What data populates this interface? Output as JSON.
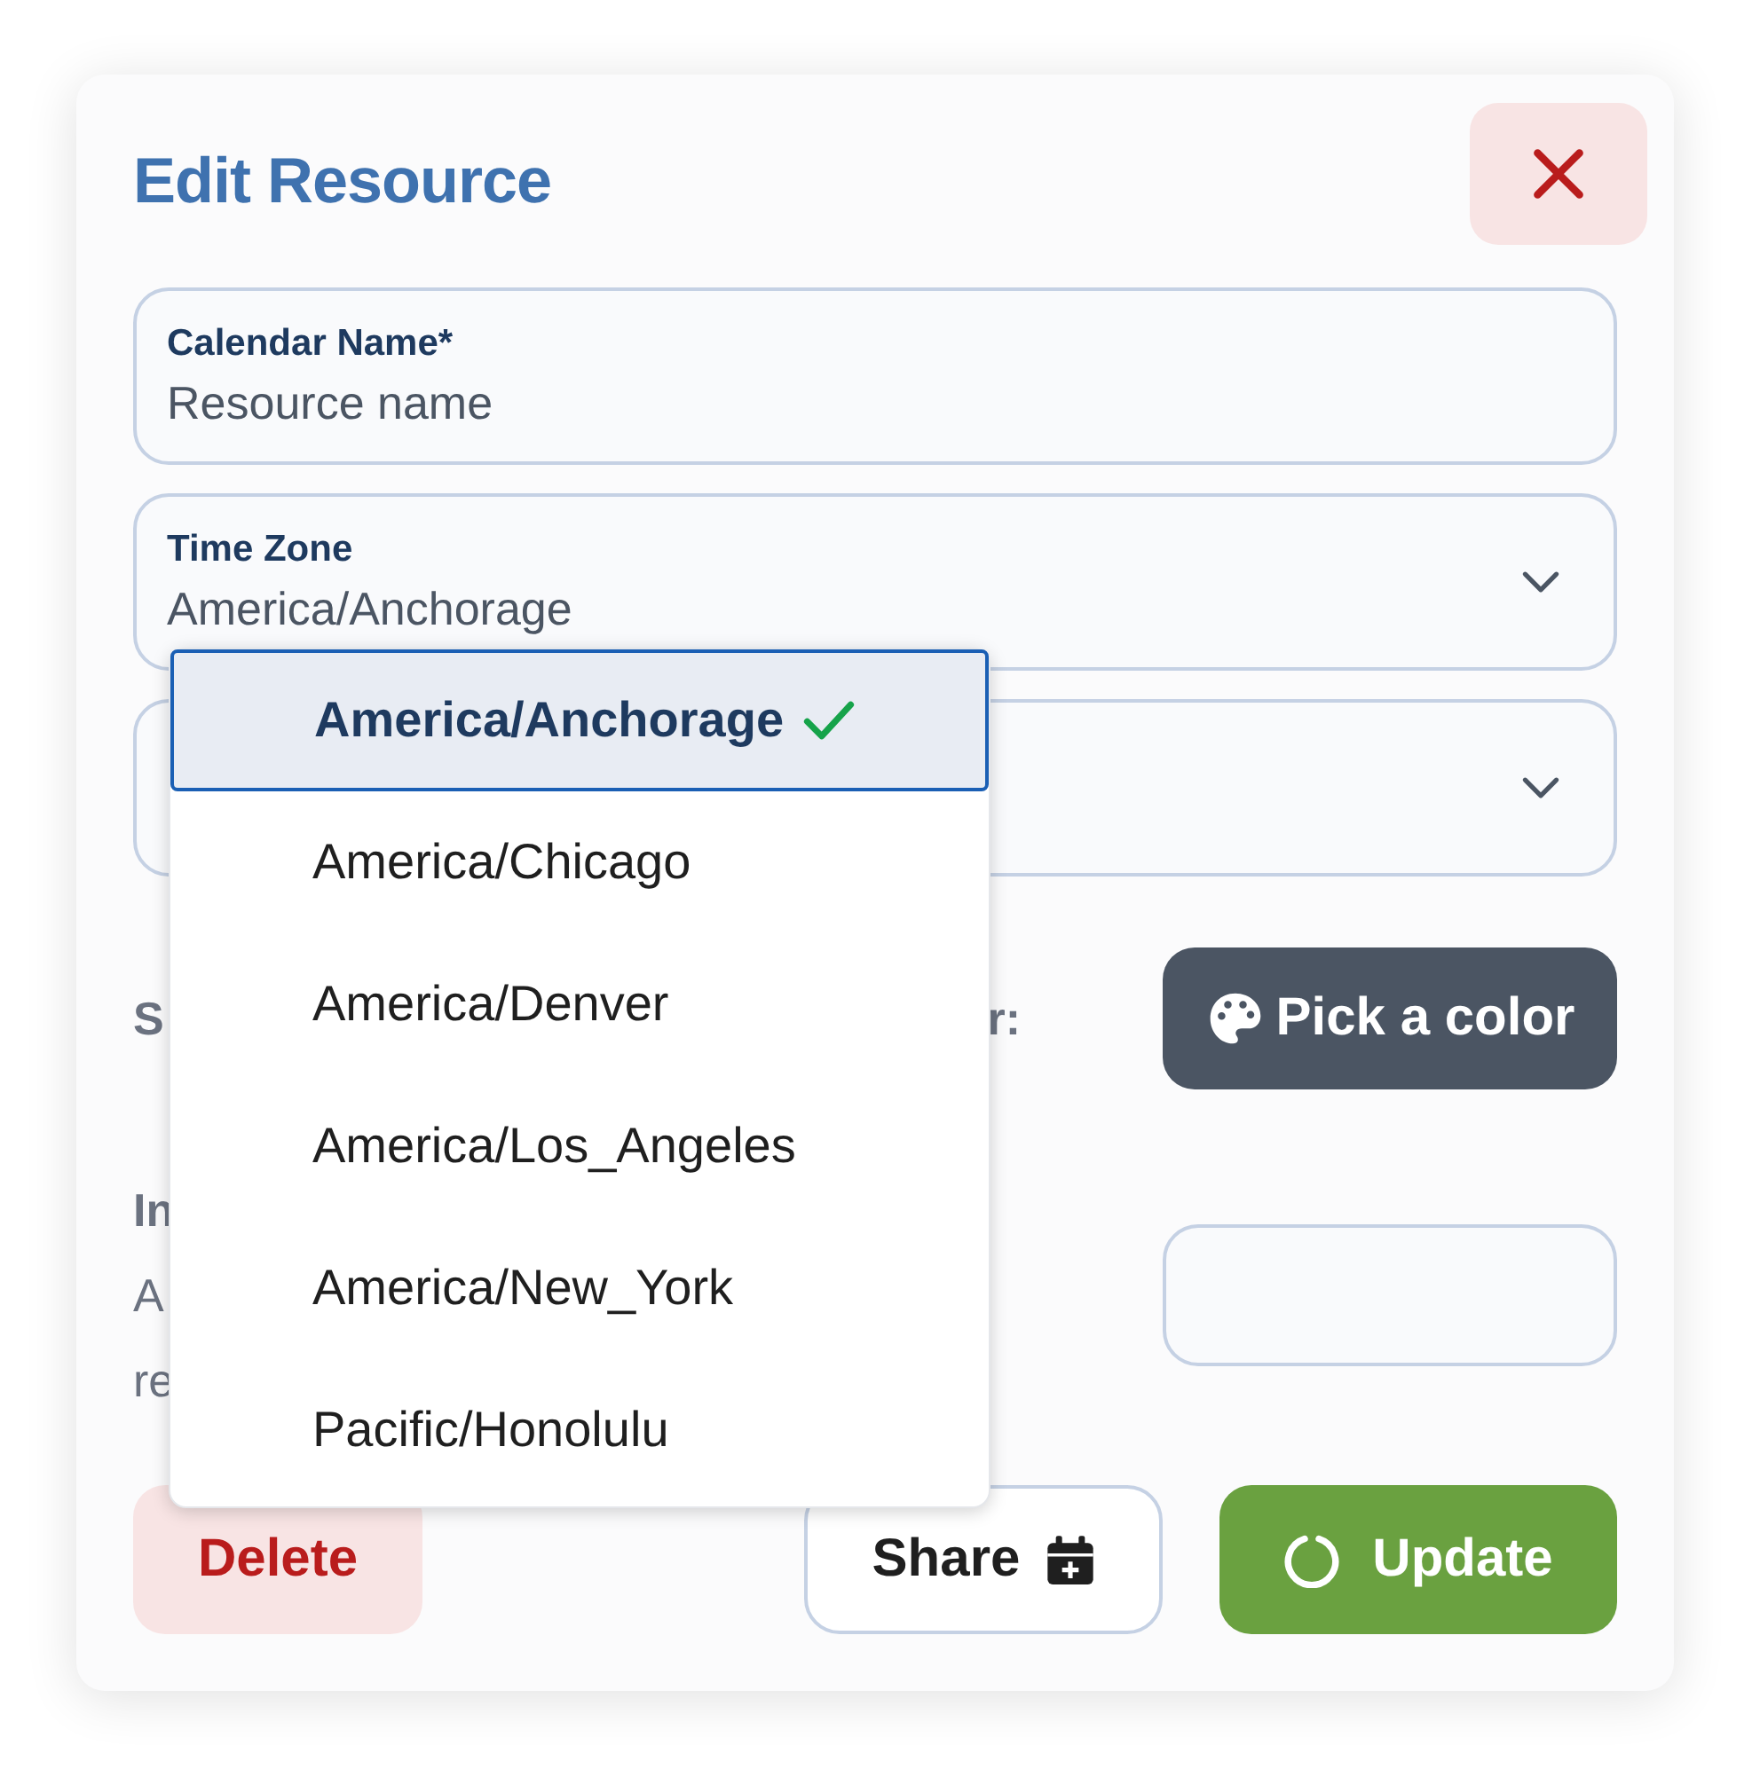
{
  "dialog": {
    "title": "Edit Resource"
  },
  "fields": [
    {
      "kind": "text",
      "label": "Calendar Name*",
      "placeholder": "Resource name"
    },
    {
      "kind": "select",
      "label": "Time Zone",
      "value": "America/Anchorage"
    },
    {
      "kind": "select"
    }
  ],
  "color_row": {
    "label_start": "S",
    "label_end": "r:",
    "button": "Pick a color"
  },
  "import_row": {
    "lines": [
      {
        "kind": "heading",
        "text": "In"
      },
      {
        "kind": "body",
        "text": "A"
      },
      {
        "kind": "body",
        "text": "re"
      }
    ]
  },
  "footer": {
    "delete": "Delete",
    "share": "Share",
    "update": "Update"
  },
  "dropdown": {
    "options": [
      {
        "label": "America/Anchorage",
        "selected": true
      },
      {
        "label": "America/Chicago",
        "selected": false
      },
      {
        "label": "America/Denver",
        "selected": false
      },
      {
        "label": "America/Los_Angeles",
        "selected": false
      },
      {
        "label": "America/New_York",
        "selected": false
      },
      {
        "label": "Pacific/Honolulu",
        "selected": false
      }
    ]
  }
}
